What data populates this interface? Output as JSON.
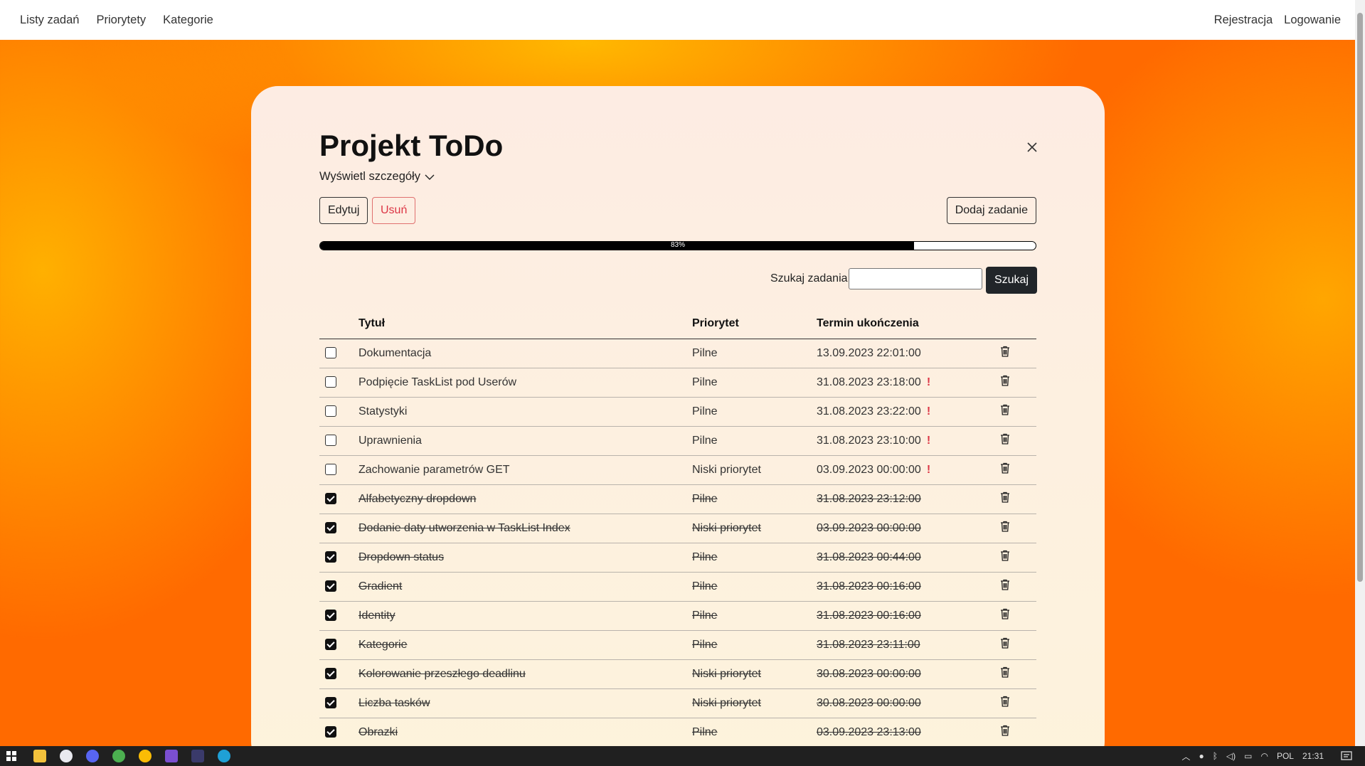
{
  "nav": {
    "left": [
      "Listy zadań",
      "Priorytety",
      "Kategorie"
    ],
    "right": [
      "Rejestracja",
      "Logowanie"
    ]
  },
  "list": {
    "title": "Projekt ToDo",
    "details_toggle": "Wyświetl szczegóły",
    "edit_label": "Edytuj",
    "delete_label": "Usuń",
    "add_task_label": "Dodaj zadanie",
    "progress": {
      "value": 83,
      "label": "83%"
    }
  },
  "search": {
    "label": "Szukaj zadania:",
    "value": "",
    "button": "Szukaj"
  },
  "table": {
    "headers": {
      "title": "Tytuł",
      "priority": "Priorytet",
      "deadline": "Termin ukończenia"
    },
    "rows": [
      {
        "title": "Dokumentacja",
        "priority": "Pilne",
        "deadline": "13.09.2023 22:01:00",
        "done": false,
        "overdue": false
      },
      {
        "title": "Podpięcie TaskList pod Userów",
        "priority": "Pilne",
        "deadline": "31.08.2023 23:18:00",
        "done": false,
        "overdue": true
      },
      {
        "title": "Statystyki",
        "priority": "Pilne",
        "deadline": "31.08.2023 23:22:00",
        "done": false,
        "overdue": true
      },
      {
        "title": "Uprawnienia",
        "priority": "Pilne",
        "deadline": "31.08.2023 23:10:00",
        "done": false,
        "overdue": true
      },
      {
        "title": "Zachowanie parametrów GET",
        "priority": "Niski priorytet",
        "deadline": "03.09.2023 00:00:00",
        "done": false,
        "overdue": true
      },
      {
        "title": "Alfabetyczny dropdown",
        "priority": "Pilne",
        "deadline": "31.08.2023 23:12:00",
        "done": true,
        "overdue": false
      },
      {
        "title": "Dodanie daty utworzenia w TaskList Index",
        "priority": "Niski priorytet",
        "deadline": "03.09.2023 00:00:00",
        "done": true,
        "overdue": false
      },
      {
        "title": "Dropdown status",
        "priority": "Pilne",
        "deadline": "31.08.2023 00:44:00",
        "done": true,
        "overdue": false
      },
      {
        "title": "Gradient",
        "priority": "Pilne",
        "deadline": "31.08.2023 00:16:00",
        "done": true,
        "overdue": false
      },
      {
        "title": "Identity",
        "priority": "Pilne",
        "deadline": "31.08.2023 00:16:00",
        "done": true,
        "overdue": false
      },
      {
        "title": "Kategorie",
        "priority": "Pilne",
        "deadline": "31.08.2023 23:11:00",
        "done": true,
        "overdue": false
      },
      {
        "title": "Kolorowanie przeszłego deadlinu",
        "priority": "Niski priorytet",
        "deadline": "30.08.2023 00:00:00",
        "done": true,
        "overdue": false
      },
      {
        "title": "Liczba tasków",
        "priority": "Niski priorytet",
        "deadline": "30.08.2023 00:00:00",
        "done": true,
        "overdue": false
      },
      {
        "title": "Obrazki",
        "priority": "Pilne",
        "deadline": "03.09.2023 23:13:00",
        "done": true,
        "overdue": false
      }
    ]
  },
  "overdue_mark": "!",
  "taskbar": {
    "lang": "POL",
    "time": "21:31"
  },
  "colors": {
    "accent": "#ff6a00",
    "danger": "#dc3545",
    "dark": "#212529"
  }
}
